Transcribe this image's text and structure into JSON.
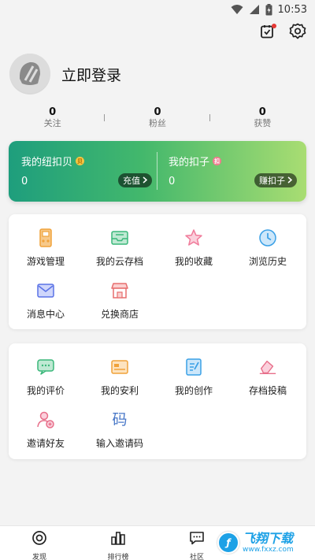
{
  "status_bar": {
    "time": "10:53"
  },
  "profile": {
    "login_text": "立即登录"
  },
  "stats": [
    {
      "value": "0",
      "label": "关注"
    },
    {
      "value": "0",
      "label": "粉丝"
    },
    {
      "value": "0",
      "label": "获赞"
    }
  ],
  "wallet": {
    "left": {
      "title": "我的纽扣贝",
      "value": "0",
      "button": "充值",
      "coin_letter": "贝"
    },
    "right": {
      "title": "我的扣子",
      "value": "0",
      "button": "赚扣子",
      "coin_letter": "扣"
    }
  },
  "card1": [
    {
      "label": "游戏管理",
      "icon": "gamepad-icon"
    },
    {
      "label": "我的云存档",
      "icon": "cloud-save-icon"
    },
    {
      "label": "我的收藏",
      "icon": "star-icon"
    },
    {
      "label": "浏览历史",
      "icon": "clock-icon"
    },
    {
      "label": "消息中心",
      "icon": "mail-icon"
    },
    {
      "label": "兑换商店",
      "icon": "store-icon"
    }
  ],
  "card2": [
    {
      "label": "我的评价",
      "icon": "comment-icon"
    },
    {
      "label": "我的安利",
      "icon": "recommend-card-icon"
    },
    {
      "label": "我的创作",
      "icon": "document-edit-icon"
    },
    {
      "label": "存档投稿",
      "icon": "eraser-upload-icon"
    },
    {
      "label": "邀请好友",
      "icon": "invite-user-icon"
    },
    {
      "label": "输入邀请码",
      "icon": "code-icon",
      "glyph": "码"
    }
  ],
  "bottom_nav": [
    {
      "label": "发现",
      "icon": "discover-icon"
    },
    {
      "label": "排行榜",
      "icon": "ranking-icon"
    },
    {
      "label": "社区",
      "icon": "community-icon"
    }
  ],
  "watermark": {
    "title": "飞翔下载",
    "url": "www.fxxz.com"
  },
  "colors": {
    "wallet_gradient_start": "#1e9e7d",
    "wallet_gradient_end": "#a9dd72",
    "accent_orange": "#f0a23a",
    "accent_green": "#3ab77a",
    "accent_pink": "#f07b9a",
    "accent_blue": "#3aa0e6"
  }
}
